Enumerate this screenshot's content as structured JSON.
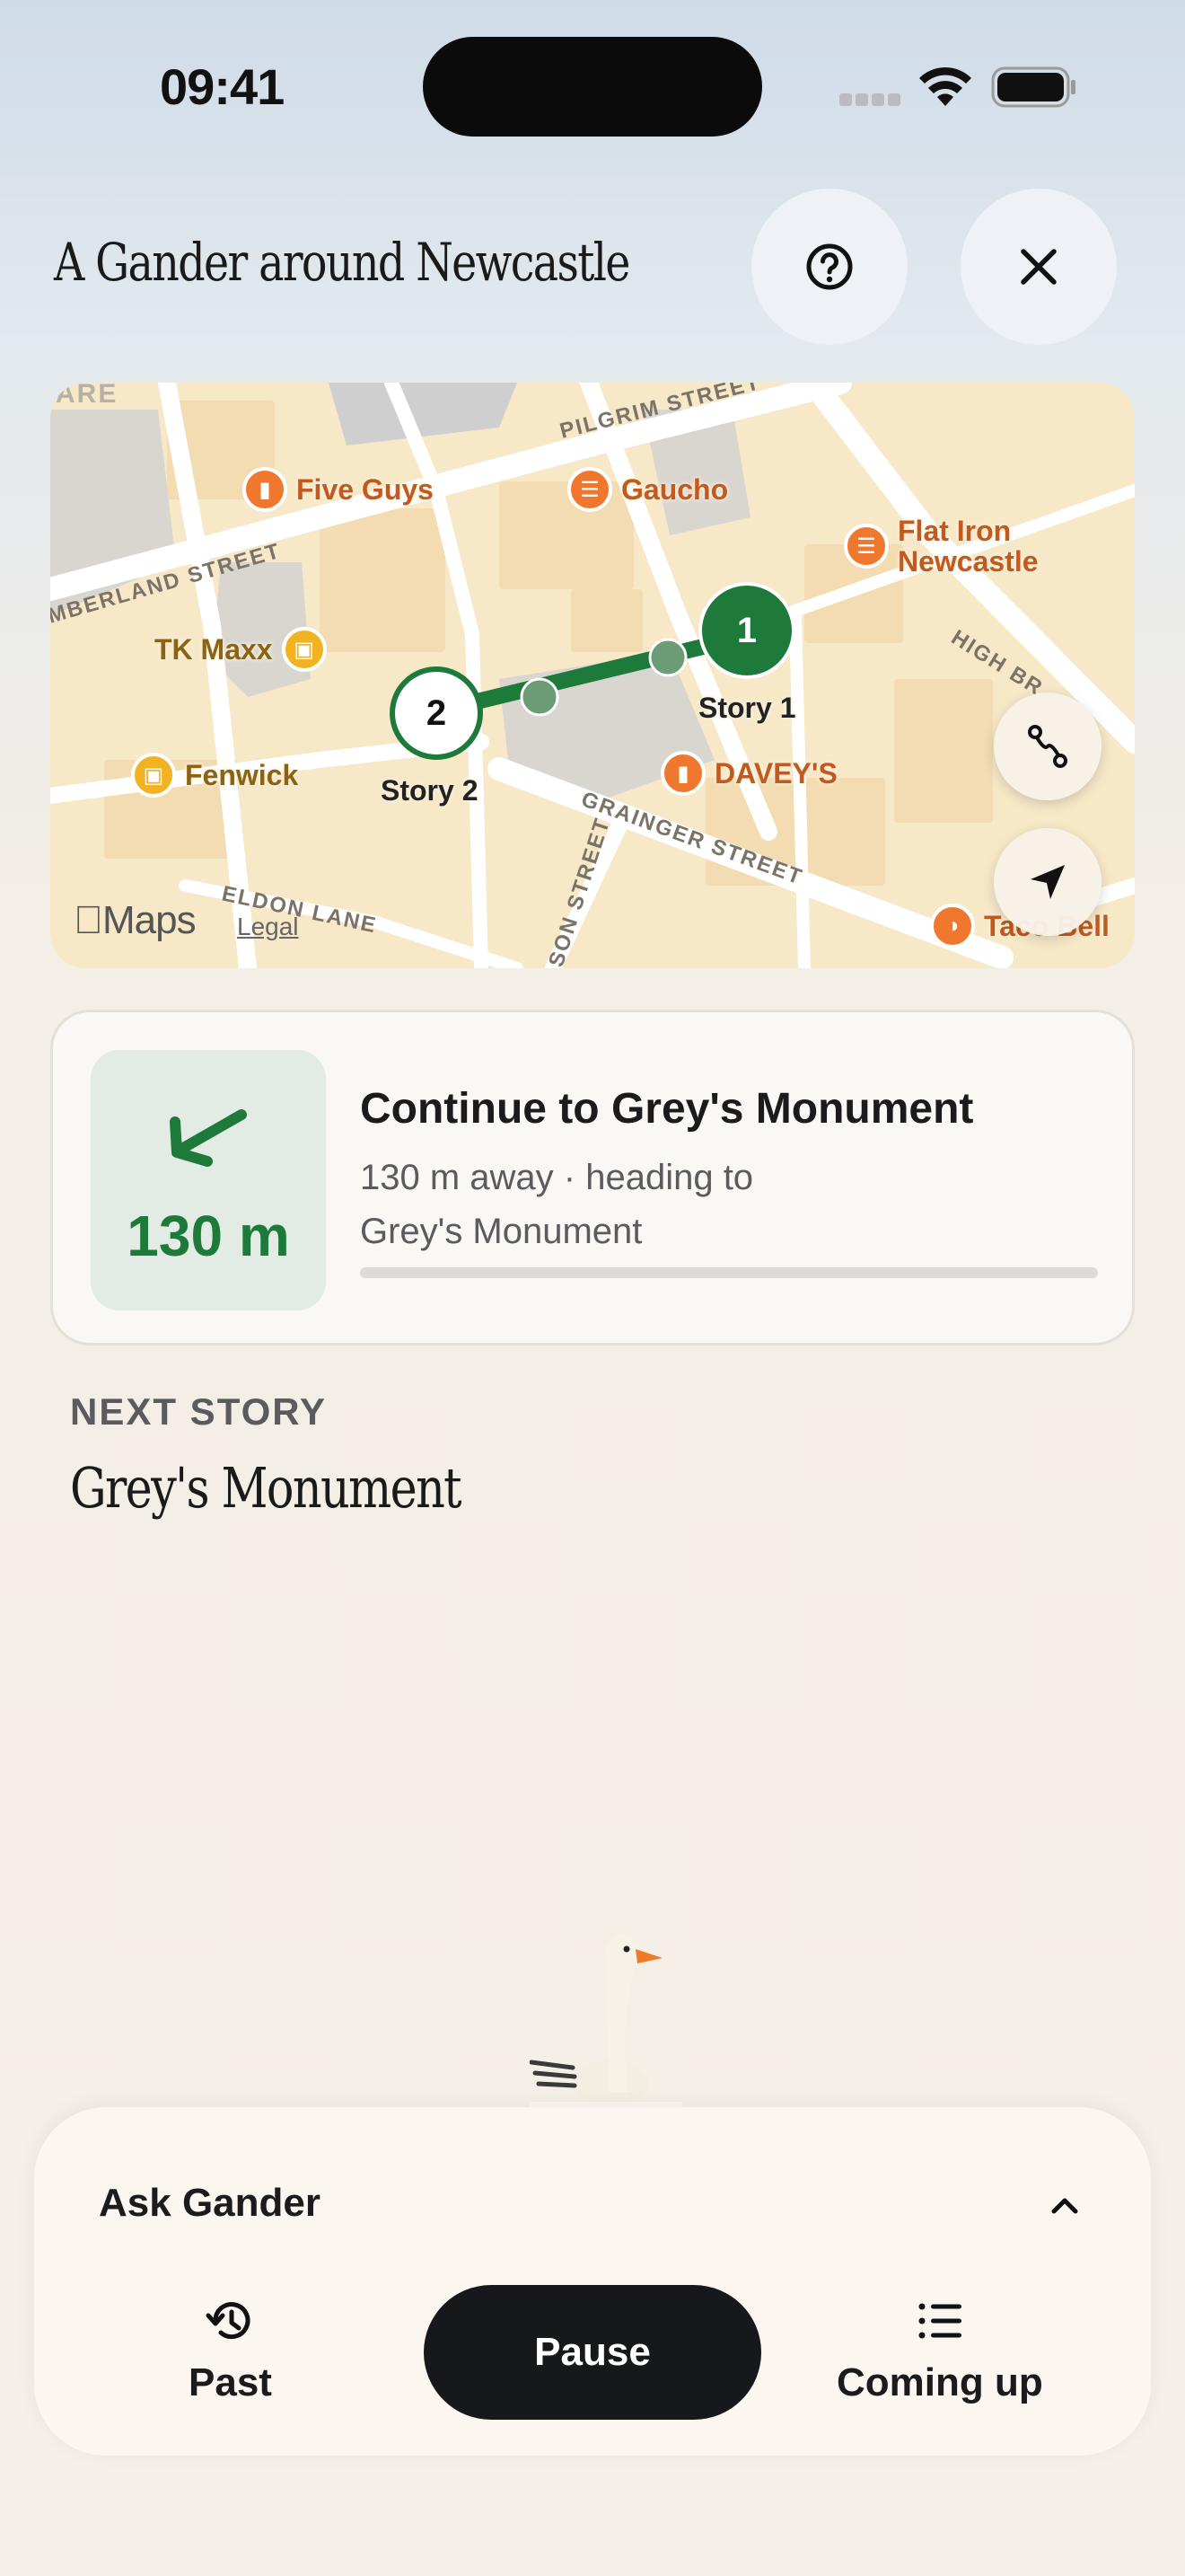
{
  "status_bar": {
    "time": "09:41",
    "icons": [
      "cellular-signal-icon",
      "wifi-icon",
      "battery-icon"
    ]
  },
  "header": {
    "title": "A Gander around Newcastle",
    "help_icon": "question-circle-icon",
    "close_icon": "close-icon"
  },
  "map": {
    "street_labels": [
      "PILGRIM STREET",
      "MBERLAND STREET",
      "HIGH BR",
      "GRAINGER STREET",
      "ELDON LANE",
      "SON STREET",
      "ARE"
    ],
    "pois": [
      {
        "name": "Five Guys",
        "icon": "fast-food-icon",
        "color": "#f0782e"
      },
      {
        "name": "Gaucho",
        "icon": "restaurant-icon",
        "color": "#f0782e"
      },
      {
        "name": "Flat Iron\nNewcastle",
        "icon": "restaurant-icon",
        "color": "#f0782e"
      },
      {
        "name": "TK Maxx",
        "icon": "shopping-bag-icon",
        "color": "#f2b322"
      },
      {
        "name": "Fenwick",
        "icon": "shopping-bag-icon",
        "color": "#f2b322"
      },
      {
        "name": "DAVEY'S",
        "icon": "fast-food-icon",
        "color": "#f0782e"
      },
      {
        "name": "Taco Bell",
        "icon": "taco-icon",
        "color": "#f0782e"
      }
    ],
    "stops": [
      {
        "number": "1",
        "label": "Story 1"
      },
      {
        "number": "2",
        "label": "Story 2"
      }
    ],
    "brand": "Maps",
    "legal": "Legal",
    "route_button_icon": "route-icon",
    "locate_button_icon": "location-arrow-icon",
    "route_color": "#1e7a3a"
  },
  "navigation": {
    "direction_icon": "arrow-left-icon",
    "distance": "130 m",
    "title": "Continue to Grey's Monument",
    "subtitle": "130 m away · heading to Grey's Monument",
    "progress": 0.0,
    "accent_color": "#1e7a3a"
  },
  "next_story": {
    "label": "NEXT STORY",
    "title": "Grey's Monument"
  },
  "bottom_sheet": {
    "ask_label": "Ask Gander",
    "chevron_icon": "chevron-up-icon",
    "past_label": "Past",
    "past_icon": "history-icon",
    "pause_label": "Pause",
    "coming_label": "Coming up",
    "coming_icon": "list-icon"
  }
}
